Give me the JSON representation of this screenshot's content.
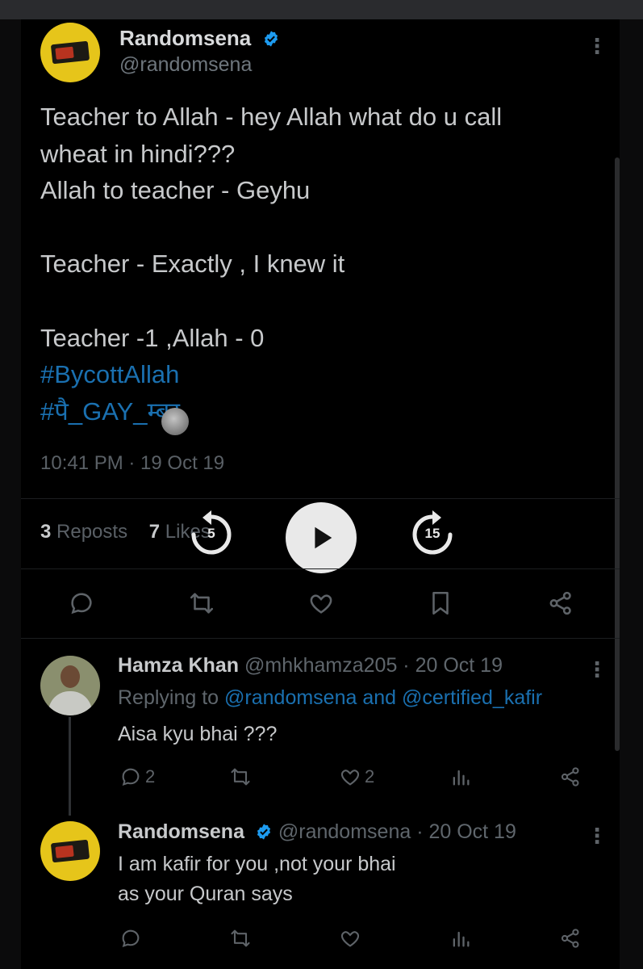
{
  "main_tweet": {
    "display_name": "Randomsena",
    "handle": "@randomsena",
    "text_lines": [
      "Teacher to Allah - hey Allah what do u call",
      "wheat in hindi???",
      "Allah to teacher - Geyhu",
      "",
      "Teacher - Exactly , I knew it",
      "",
      "Teacher -1 ,Allah - 0"
    ],
    "hashtags": [
      "#BycottAllah",
      "#पै_GAY_म्बर"
    ],
    "timestamp": "10:41 PM · 19 Oct 19",
    "reposts_count": "3",
    "reposts_label": "Reposts",
    "likes_count": "7",
    "likes_label": "Likes"
  },
  "video_player": {
    "rewind_seconds": "5",
    "forward_seconds": "15"
  },
  "replies": [
    {
      "display_name": "Hamza Khan",
      "meta": "@mhkhamza205 · 20 Oct 19",
      "replying_prefix": "Replying to",
      "replying_user1": "@randomsena",
      "replying_and": "and",
      "replying_user2": "@certified_kafir",
      "text": "Aisa kyu bhai ???",
      "reply_count": "2",
      "like_count": "2"
    },
    {
      "display_name": "Randomsena",
      "meta": "@randomsena · 20 Oct 19",
      "text_lines": [
        "I am kafir for you ,not your bhai",
        "as your Quran says"
      ]
    }
  ],
  "colors": {
    "link": "#1a70b0",
    "verified": "#1d9bf0",
    "avatar_yellow": "#e6c51a",
    "background": "#000000"
  },
  "icons": [
    "reply-icon",
    "repost-icon",
    "like-icon",
    "bookmark-icon",
    "share-icon",
    "analytics-icon",
    "verified-icon",
    "more-icon",
    "play-icon",
    "rewind-icon",
    "forward-icon"
  ]
}
